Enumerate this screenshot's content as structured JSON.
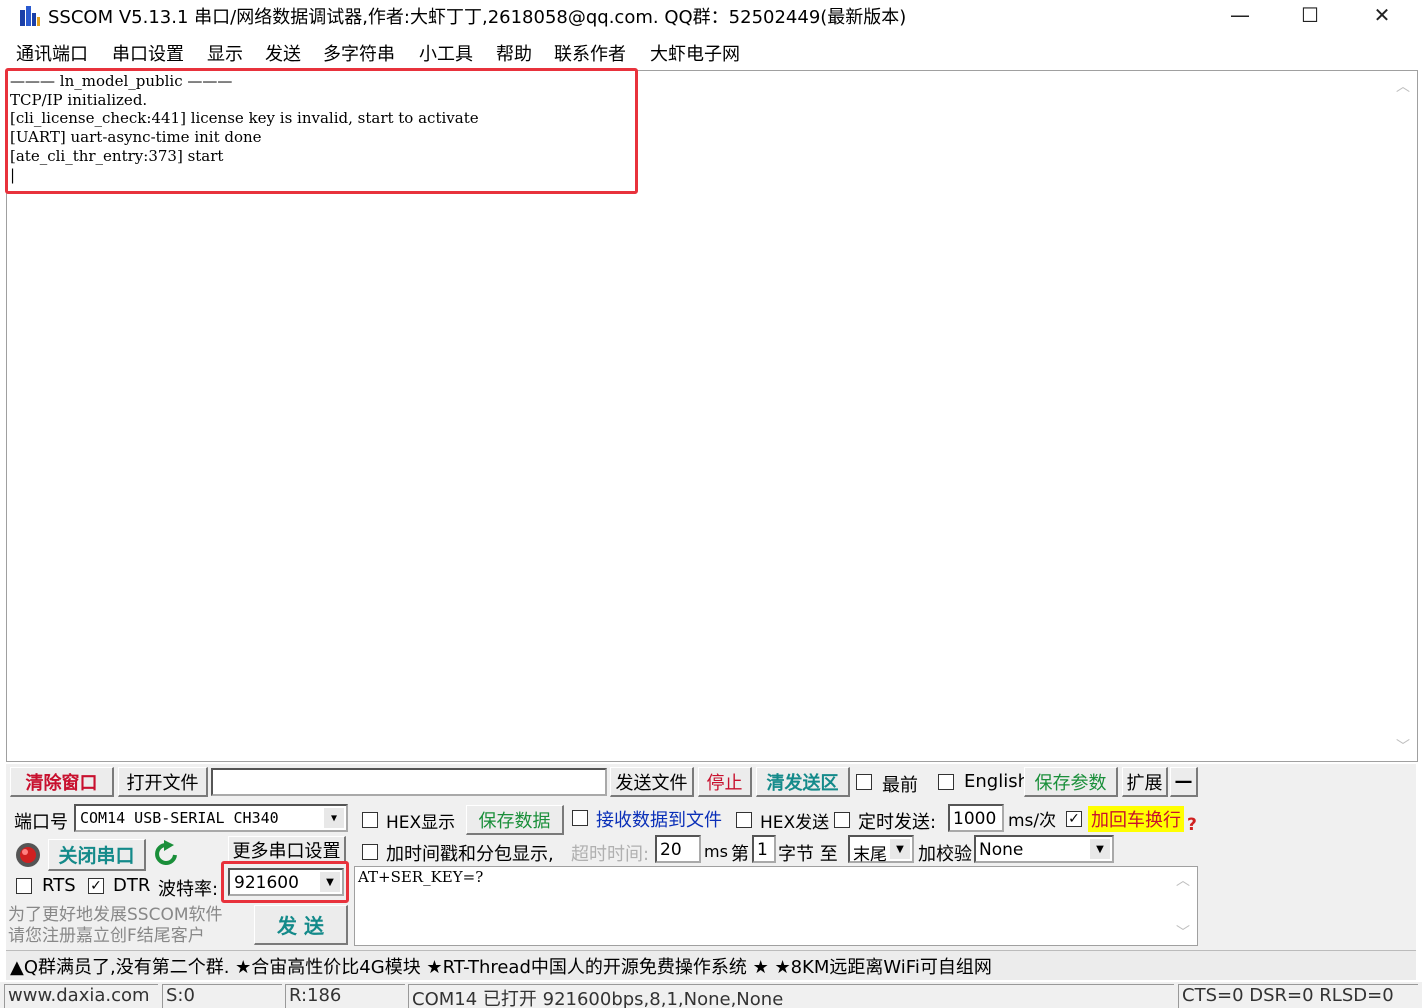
{
  "window": {
    "title": "SSCOM V5.13.1 串口/网络数据调试器,作者:大虾丁丁,2618058@qq.com. QQ群：52502449(最新版本)",
    "minimize": "—",
    "maximize": "☐",
    "close": "✕"
  },
  "menu": [
    "通讯端口",
    "串口设置",
    "显示",
    "发送",
    "多字符串",
    "小工具",
    "帮助",
    "联系作者",
    "大虾电子网"
  ],
  "receive": {
    "text": "——— ln_model_public ———\nTCP/IP initialized.\n[cli_license_check:441] license key is invalid, start to activate\n[UART] uart-async-time init done\n[ate_cli_thr_entry:373] start\n|"
  },
  "toolbar": {
    "clear": "清除窗口",
    "open_file": "打开文件",
    "file_path": "",
    "send_file": "发送文件",
    "stop": "停止",
    "clear_send": "清发送区",
    "front": "最前",
    "english": "English",
    "save_params": "保存参数",
    "expand": "扩展",
    "collapse": "—"
  },
  "port": {
    "label": "端口号",
    "value": "COM14 USB-SERIAL CH340",
    "close_port": "关闭串口",
    "more_settings": "更多串口设置",
    "rts": "RTS",
    "dtr": "DTR",
    "baud_label": "波特率:",
    "baud_value": "921600",
    "rts_checked": false,
    "dtr_checked": true
  },
  "options": {
    "hex_display": "HEX显示",
    "save_data": "保存数据",
    "recv_to_file": "接收数据到文件",
    "hex_send": "HEX发送",
    "timed_send": "定时发送:",
    "timed_value": "1000",
    "timed_unit": "ms/次",
    "add_crlf": "加回车换行",
    "add_timestamp": "加时间戳和分包显示,",
    "timeout_label": "超时时间:",
    "timeout_value": "20",
    "timeout_unit": "ms",
    "nth_label": "第",
    "nth_value": "1",
    "byte_to": "字节 至",
    "end_value": "末尾",
    "checksum_label": "加校验",
    "checksum_value": "None",
    "question": "?",
    "crlf_checked": true
  },
  "send": {
    "text": "AT+SER_KEY=?",
    "button": "发  送"
  },
  "promo": {
    "line1": "为了更好地发展SSCOM软件",
    "line2": "请您注册嘉立创F结尾客户"
  },
  "tips": "▲Q群满员了,没有第二个群. ★合宙高性价比4G模块 ★RT-Thread中国人的开源免费操作系统 ★ ★8KM远距离WiFi可自组网",
  "status": {
    "website": "www.daxia.com",
    "sent": "S:0",
    "received": "R:186",
    "port_info": "COM14 已打开  921600bps,8,1,None,None",
    "lines": "CTS=0 DSR=0 RLSD=0"
  },
  "colors": {
    "highlight": "#e8323c",
    "red_text": "#c8102e",
    "green_text": "#1a8f3a",
    "blue_text": "#0a2fb8",
    "teal_text": "#148a8a",
    "yellow_bg": "#ffff00"
  }
}
